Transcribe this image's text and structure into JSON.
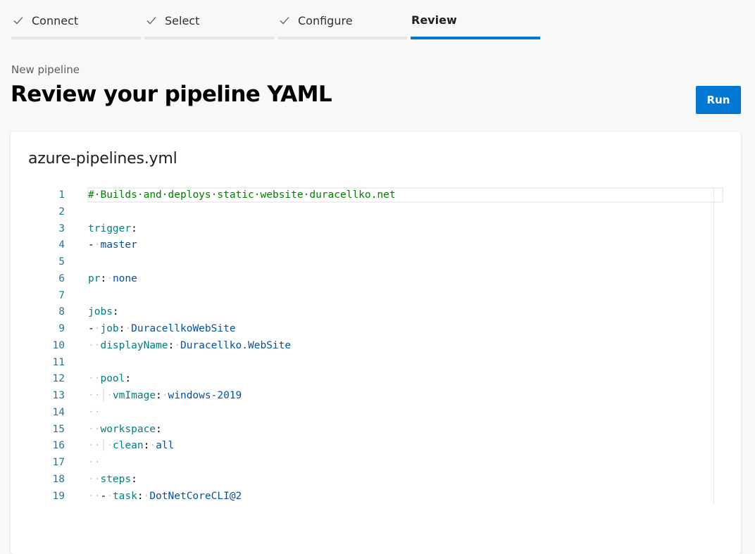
{
  "stepper": {
    "steps": [
      {
        "label": "Connect",
        "completed": true,
        "active": false
      },
      {
        "label": "Select",
        "completed": true,
        "active": false
      },
      {
        "label": "Configure",
        "completed": true,
        "active": false
      },
      {
        "label": "Review",
        "completed": false,
        "active": true
      }
    ]
  },
  "header": {
    "breadcrumb": "New pipeline",
    "title": "Review your pipeline YAML",
    "run_label": "Run"
  },
  "editor": {
    "file_name": "azure-pipelines.yml",
    "lines": [
      {
        "num": "1",
        "text": "# Builds and deploys static website duracellko.net"
      },
      {
        "num": "2",
        "text": ""
      },
      {
        "num": "3",
        "text": "trigger:"
      },
      {
        "num": "4",
        "text": "- master"
      },
      {
        "num": "5",
        "text": ""
      },
      {
        "num": "6",
        "text": "pr: none"
      },
      {
        "num": "7",
        "text": ""
      },
      {
        "num": "8",
        "text": "jobs:"
      },
      {
        "num": "9",
        "text": "- job: DuracellkoWebSite"
      },
      {
        "num": "10",
        "text": "  displayName: Duracellko.WebSite"
      },
      {
        "num": "11",
        "text": ""
      },
      {
        "num": "12",
        "text": "  pool:"
      },
      {
        "num": "13",
        "text": "    vmImage: windows-2019"
      },
      {
        "num": "14",
        "text": "  "
      },
      {
        "num": "15",
        "text": "  workspace:"
      },
      {
        "num": "16",
        "text": "    clean: all"
      },
      {
        "num": "17",
        "text": "  "
      },
      {
        "num": "18",
        "text": "  steps:"
      },
      {
        "num": "19",
        "text": "  - task: DotNetCoreCLI@2"
      }
    ]
  },
  "colors": {
    "accent": "#0078d4",
    "line_number": "#237893",
    "comment": "#008000",
    "yaml_key": "#008080",
    "yaml_value": "#0451a5"
  }
}
